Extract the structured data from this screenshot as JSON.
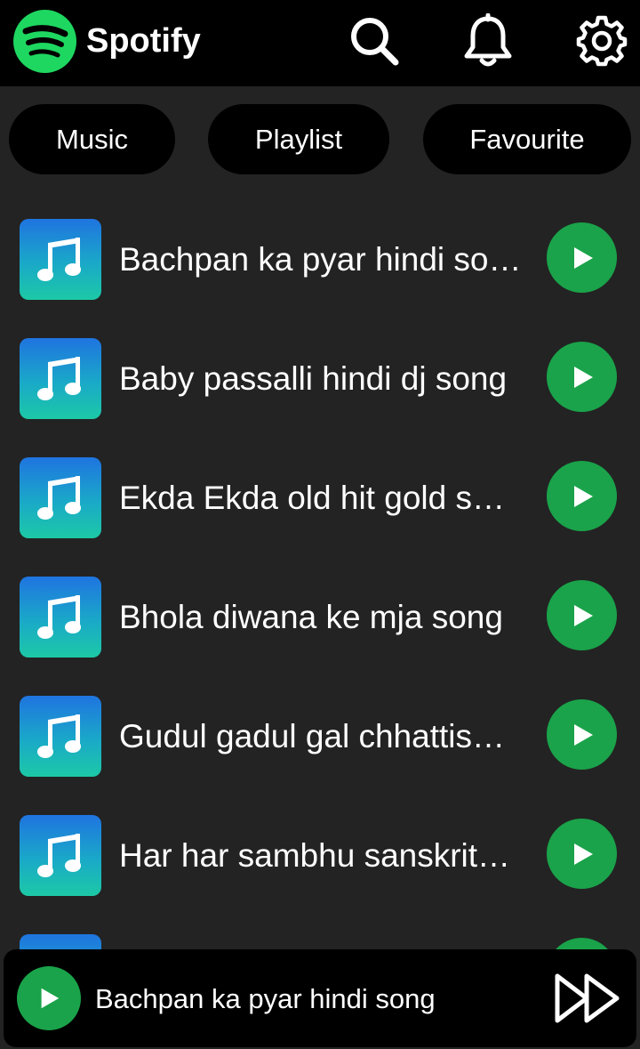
{
  "app": {
    "brand": "Spotify"
  },
  "colors": {
    "accent_green": "#1aa34a",
    "logo_green": "#1ed760",
    "header_bg": "#000000",
    "page_bg": "#232323",
    "thumb_gradient_top": "#1f74e0",
    "thumb_gradient_bottom": "#1cc9a6"
  },
  "header": {
    "icons": [
      "spotify-logo-icon",
      "search-icon",
      "bell-icon",
      "gear-icon"
    ]
  },
  "chips": [
    {
      "label": "Music"
    },
    {
      "label": "Playlist"
    },
    {
      "label": "Favourite"
    }
  ],
  "songs": [
    {
      "title": "Bachpan ka pyar hindi so…"
    },
    {
      "title": "Baby passalli hindi dj song"
    },
    {
      "title": "Ekda Ekda old hit gold so…"
    },
    {
      "title": "Bhola diwana ke mja song"
    },
    {
      "title": "Gudul gadul gal chhattis…"
    },
    {
      "title": "Har har sambhu sanskrit…"
    },
    {
      "title": ""
    }
  ],
  "player": {
    "now_playing": "Bachpan ka pyar hindi song",
    "icons": [
      "play-icon",
      "fast-forward-icon"
    ]
  }
}
